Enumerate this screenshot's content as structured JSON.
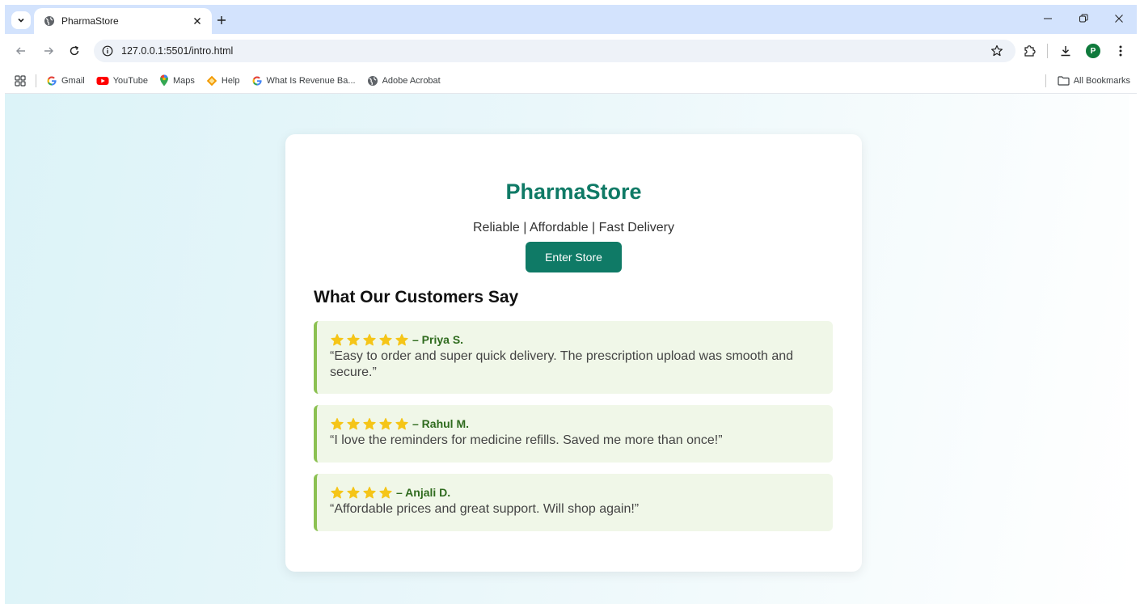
{
  "browser": {
    "tab_title": "PharmaStore",
    "url": "127.0.0.1:5501/intro.html",
    "avatar_letter": "P",
    "bookmarks": [
      {
        "label": "Gmail",
        "icon": "google-icon"
      },
      {
        "label": "YouTube",
        "icon": "youtube-icon"
      },
      {
        "label": "Maps",
        "icon": "maps-pin-icon"
      },
      {
        "label": "Help",
        "icon": "help-diamond-icon"
      },
      {
        "label": "What Is Revenue Ba...",
        "icon": "google-icon"
      },
      {
        "label": "Adobe Acrobat",
        "icon": "globe-icon"
      }
    ],
    "all_bookmarks_label": "All Bookmarks"
  },
  "page": {
    "title": "PharmaStore",
    "tagline": "Reliable | Affordable | Fast Delivery",
    "enter_button": "Enter Store",
    "testimonials_heading": "What Our Customers Say",
    "reviews": [
      {
        "stars": 5,
        "author": "– Priya S.",
        "text": "“Easy to order and super quick delivery. The prescription upload was smooth and secure.”"
      },
      {
        "stars": 5,
        "author": "– Rahul M.",
        "text": "“I love the reminders for medicine refills. Saved me more than once!”"
      },
      {
        "stars": 4,
        "author": "– Anjali D.",
        "text": "“Affordable prices and great support. Will shop again!”"
      }
    ]
  },
  "colors": {
    "brand": "#0f7a66",
    "review_bg": "#f0f7e8",
    "review_border": "#8cc152",
    "star": "#f5c518",
    "author": "#2f6b1e"
  }
}
